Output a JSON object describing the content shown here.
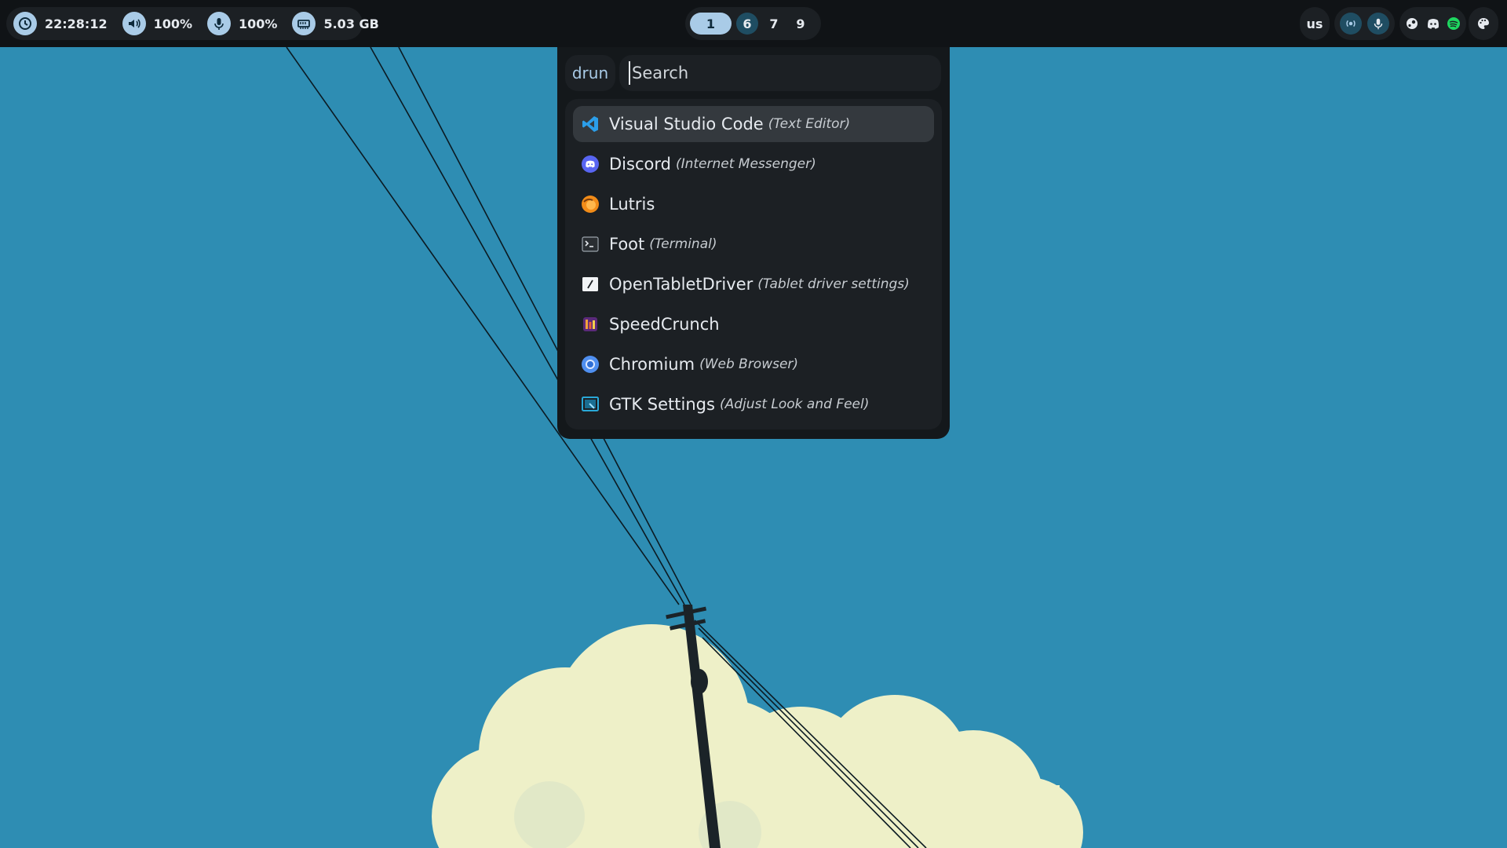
{
  "topbar": {
    "clock": {
      "icon": "clock-icon",
      "label": "22:28:12"
    },
    "volume": {
      "icon": "speaker-icon",
      "label": "100%"
    },
    "mic": {
      "icon": "microphone-icon",
      "label": "100%"
    },
    "memory": {
      "icon": "memory-icon",
      "label": "5.03 GB"
    },
    "workspaces": [
      {
        "label": "1",
        "state": "active"
      },
      {
        "label": "6",
        "state": "occupied"
      },
      {
        "label": "7",
        "state": "plain"
      },
      {
        "label": "9",
        "state": "plain"
      }
    ],
    "keyboard_layout": "us",
    "media_icons": [
      "broadcast-icon",
      "microphone-icon"
    ],
    "tray_icons": [
      "steam-icon",
      "discord-icon",
      "spotify-icon"
    ],
    "theme_icon": "palette-icon"
  },
  "launcher": {
    "mode": "drun",
    "search_placeholder": "Search",
    "search_value": "",
    "items": [
      {
        "name": "Visual Studio Code",
        "generic": "(Text Editor)",
        "icon": "vscode-icon",
        "selected": true
      },
      {
        "name": "Discord",
        "generic": "(Internet Messenger)",
        "icon": "discord-icon",
        "selected": false
      },
      {
        "name": "Lutris",
        "generic": "",
        "icon": "lutris-icon",
        "selected": false
      },
      {
        "name": "Foot",
        "generic": "(Terminal)",
        "icon": "terminal-icon",
        "selected": false
      },
      {
        "name": "OpenTabletDriver",
        "generic": "(Tablet driver settings)",
        "icon": "tablet-icon",
        "selected": false
      },
      {
        "name": "SpeedCrunch",
        "generic": "",
        "icon": "calculator-icon",
        "selected": false
      },
      {
        "name": "Chromium",
        "generic": "(Web Browser)",
        "icon": "chromium-icon",
        "selected": false
      },
      {
        "name": "GTK Settings",
        "generic": "(Adjust Look and Feel)",
        "icon": "gtk-settings-icon",
        "selected": false
      }
    ]
  },
  "colors": {
    "sky": "#2e8db3",
    "bar_bg": "#101316",
    "accent": "#a9cbe7",
    "cloud": "#eef0c8"
  }
}
